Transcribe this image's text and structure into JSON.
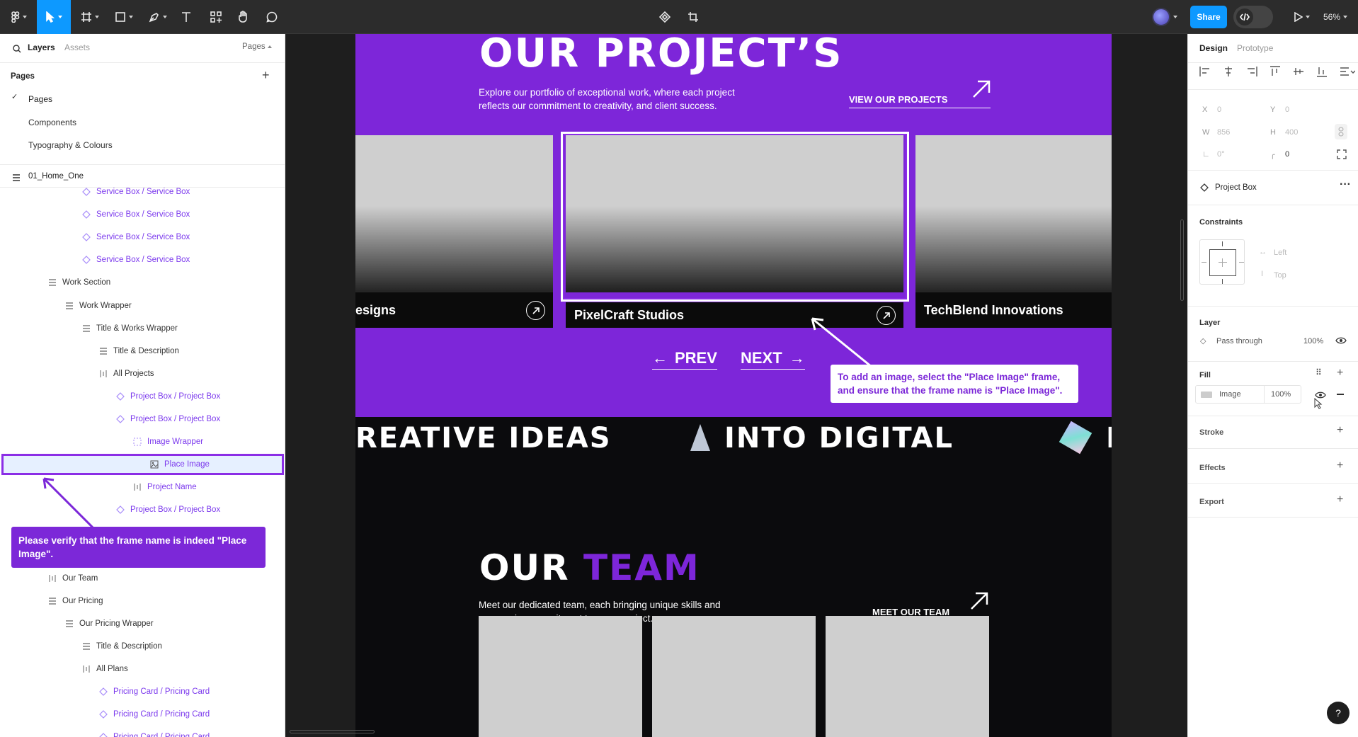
{
  "topbar": {
    "share_label": "Share",
    "zoom": "56%",
    "code_icon": "code-icon"
  },
  "left_panel": {
    "tabs": {
      "layers": "Layers",
      "assets": "Assets",
      "pages": "Pages"
    },
    "pages_heading": "Pages",
    "pages": [
      "Pages",
      "Components",
      "Typography & Colours"
    ],
    "current_frame": "01_Home_One",
    "layers": [
      {
        "label": "Service Box / Service Box",
        "indent": 4,
        "kind": "instance",
        "style": "purple"
      },
      {
        "label": "Service Box / Service Box",
        "indent": 4,
        "kind": "instance",
        "style": "purple"
      },
      {
        "label": "Service Box / Service Box",
        "indent": 4,
        "kind": "instance",
        "style": "purple"
      },
      {
        "label": "Service Box / Service Box",
        "indent": 4,
        "kind": "instance",
        "style": "purple"
      },
      {
        "label": "Work Section",
        "indent": 2,
        "kind": "frame",
        "style": "dark"
      },
      {
        "label": "Work Wrapper",
        "indent": 3,
        "kind": "frame",
        "style": "dark"
      },
      {
        "label": "Title & Works Wrapper",
        "indent": 4,
        "kind": "frame",
        "style": "dark"
      },
      {
        "label": "Title & Description",
        "indent": 5,
        "kind": "frame",
        "style": "dark"
      },
      {
        "label": "All Projects",
        "indent": 5,
        "kind": "hlayout",
        "style": "dark"
      },
      {
        "label": "Project Box / Project Box",
        "indent": 6,
        "kind": "instance",
        "style": "purple"
      },
      {
        "label": "Project Box / Project Box",
        "indent": 6,
        "kind": "instance",
        "style": "purple"
      },
      {
        "label": "Image Wrapper",
        "indent": 7,
        "kind": "dashed",
        "style": "purple"
      },
      {
        "label": "Place Image",
        "indent": 8,
        "kind": "image",
        "style": "purple",
        "selected": true
      },
      {
        "label": "Project Name",
        "indent": 7,
        "kind": "hlayout",
        "style": "purple"
      },
      {
        "label": "Project Box / Project Box",
        "indent": 6,
        "kind": "instance",
        "style": "purple"
      },
      {
        "label": "",
        "indent": 0,
        "kind": "none",
        "style": "dark"
      },
      {
        "label": "",
        "indent": 0,
        "kind": "none",
        "style": "dark"
      },
      {
        "label": "Our Team",
        "indent": 2,
        "kind": "hlayout",
        "style": "dark"
      },
      {
        "label": "Our Pricing",
        "indent": 2,
        "kind": "frame",
        "style": "dark"
      },
      {
        "label": "Our Pricing Wrapper",
        "indent": 3,
        "kind": "frame",
        "style": "dark"
      },
      {
        "label": "Title & Description",
        "indent": 4,
        "kind": "frame",
        "style": "dark"
      },
      {
        "label": "All Plans",
        "indent": 4,
        "kind": "hlayout",
        "style": "dark"
      },
      {
        "label": "Pricing Card / Pricing Card",
        "indent": 5,
        "kind": "instance",
        "style": "purple"
      },
      {
        "label": "Pricing Card / Pricing Card",
        "indent": 5,
        "kind": "instance",
        "style": "purple"
      },
      {
        "label": "Pricing Card / Pricing Card",
        "indent": 5,
        "kind": "instance",
        "style": "purple"
      }
    ],
    "tooltip": "Please verify that the frame name is indeed \"Place Image\"."
  },
  "canvas": {
    "projects_title": "OUR PROJECT’S",
    "projects_desc_1": "Explore our portfolio of exceptional work, where each project",
    "projects_desc_2": "reflects our commitment to creativity, and client success.",
    "view_projects": "VIEW OUR PROJECTS",
    "cards": [
      "esigns",
      "PixelCraft Studios",
      "TechBlend Innovations"
    ],
    "prev": "PREV",
    "next": "NEXT",
    "marquee_1": "REATIVE IDEAS",
    "marquee_2": "INTO DIGITAL",
    "marquee_3": "BR",
    "team_title_1": "OUR",
    "team_title_2": "TEAM",
    "team_desc_1": "Meet our dedicated team, each bringing unique skills and",
    "team_desc_2": "unwavering commitment to every project.",
    "meet_team": "MEET OUR TEAM",
    "tooltip": "To add an image, select the \"Place Image\" frame, and ensure that the frame name is \"Place Image\"."
  },
  "right_panel": {
    "tabs": {
      "design": "Design",
      "prototype": "Prototype"
    },
    "x_label": "X",
    "x_value": "0",
    "y_label": "Y",
    "y_value": "0",
    "w_label": "W",
    "w_value": "856",
    "h_label": "H",
    "h_value": "400",
    "rotation": "0°",
    "radius": "0",
    "component_name": "Project Box",
    "constraints_heading": "Constraints",
    "constraint_h": "Left",
    "constraint_v": "Top",
    "layer_heading": "Layer",
    "blend_mode": "Pass through",
    "layer_opacity": "100%",
    "fill_heading": "Fill",
    "fill_type": "Image",
    "fill_opacity": "100%",
    "stroke_heading": "Stroke",
    "effects_heading": "Effects",
    "export_heading": "Export",
    "help": "?"
  },
  "colors": {
    "brand_purple": "#7d26d9",
    "figma_blue": "#0d99ff",
    "selection": "#8b2ee6"
  }
}
